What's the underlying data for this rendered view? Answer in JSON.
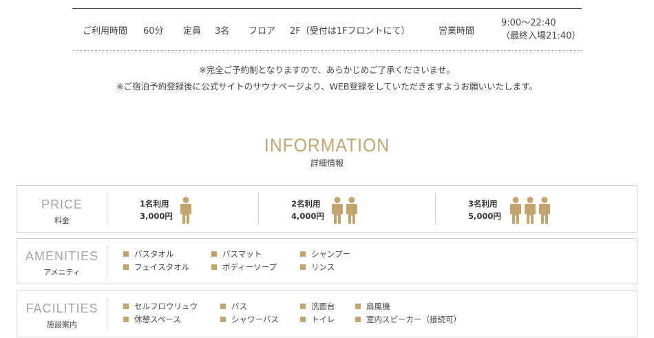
{
  "summary": {
    "usage_label": "ご利用時間",
    "usage_value": "60分",
    "capacity_label": "定員",
    "capacity_value": "3名",
    "floor_label": "フロア",
    "floor_value": "2F（受付は1Fフロントにて）",
    "hours_label": "営業時間",
    "hours_value": "9:00〜22:40",
    "hours_last": "（最終入場21:40）"
  },
  "notes": [
    "※完全ご予約制となりますので、あらかじめご了承くださいませ。",
    "※ご宿泊予約登録後に公式サイトのサウナページより、WEB登録をしていただきますようお願いいたします。"
  ],
  "information": {
    "title": "INFORMATION",
    "subtitle": "詳細情報"
  },
  "price": {
    "label_en": "PRICE",
    "label_jp": "料金",
    "items": [
      {
        "people": "1名利用",
        "amount": "3,000円",
        "count": 1
      },
      {
        "people": "2名利用",
        "amount": "4,000円",
        "count": 2
      },
      {
        "people": "3名利用",
        "amount": "5,000円",
        "count": 3
      }
    ]
  },
  "amenities": {
    "label_en": "AMENITIES",
    "label_jp": "アメニティ",
    "items": [
      "バスタオル",
      "フェイスタオル",
      "バスマット",
      "ボディーソープ",
      "シャンプー",
      "リンス"
    ]
  },
  "facilities": {
    "label_en": "FACILITIES",
    "label_jp": "施設案内",
    "items": [
      "セルフロウリュウ",
      "休憩スペース",
      "バス",
      "シャワーバス",
      "洗面台",
      "トイレ",
      "扇風機",
      "室内スピーカー（接続可）"
    ]
  },
  "colors": {
    "accent": "#c4a46a",
    "label_gray": "#a5a5a5",
    "border": "#d6d6d6"
  },
  "icons": {
    "person": "person-icon",
    "bullet": "square-bullet-icon"
  }
}
